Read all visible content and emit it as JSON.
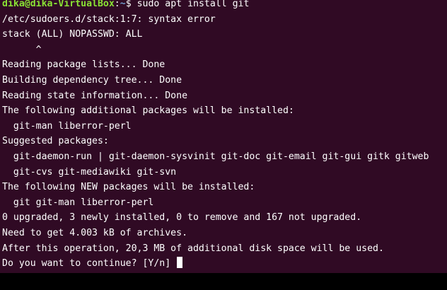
{
  "prompt": {
    "user_host": "dika@dika-VirtualBox",
    "separator": ":",
    "path": "~",
    "symbol": "$",
    "command": "sudo apt install git"
  },
  "output_lines": [
    "/etc/sudoers.d/stack:1:7: syntax error",
    "stack (ALL) NOPASSWD: ALL",
    "      ^",
    "Reading package lists... Done",
    "Building dependency tree... Done",
    "Reading state information... Done",
    "The following additional packages will be installed:",
    "  git-man liberror-perl",
    "Suggested packages:",
    "  git-daemon-run | git-daemon-sysvinit git-doc git-email git-gui gitk gitweb",
    "  git-cvs git-mediawiki git-svn",
    "The following NEW packages will be installed:",
    "  git git-man liberror-perl",
    "0 upgraded, 3 newly installed, 0 to remove and 167 not upgraded.",
    "Need to get 4.003 kB of archives.",
    "After this operation, 20,3 MB of additional disk space will be used."
  ],
  "final_prompt": "Do you want to continue? [Y/n] ",
  "colors": {
    "background": "#300a24",
    "text": "#ffffff",
    "user_host": "#8ae234",
    "path": "#729fcf"
  }
}
